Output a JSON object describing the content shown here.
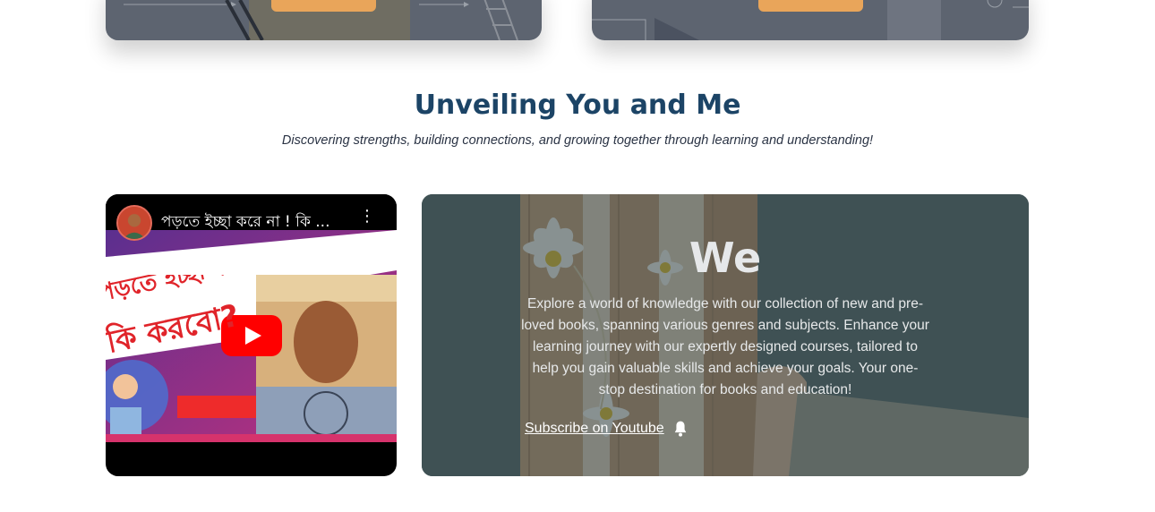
{
  "section": {
    "title": "Unveiling You and Me",
    "subtitle": "Discovering strengths, building connections, and growing together through learning and understanding!"
  },
  "video": {
    "title": "পড়তে ইচ্ছা করে না ! কি ...",
    "thumbnail_text_line1": "পড়তে ইচ্ছা করে না !!!",
    "thumbnail_text_line2": "কি করবো?"
  },
  "about_card": {
    "heading": "We",
    "body": "Explore a world of knowledge with our collection of new and pre-loved books, spanning various genres and subjects. Enhance your learning journey with our expertly designed courses, tailored to help you gain valuable skills and achieve your goals. Your one-stop destination for books and education!",
    "subscribe_label": "Subscribe on Youtube"
  },
  "colors": {
    "title": "#1c4466",
    "cta_orange": "#e9a55a",
    "youtube_red": "#ff0000"
  },
  "icons": {
    "bell": "bell-icon",
    "play": "youtube-play-icon",
    "more": "more-vert-icon"
  }
}
